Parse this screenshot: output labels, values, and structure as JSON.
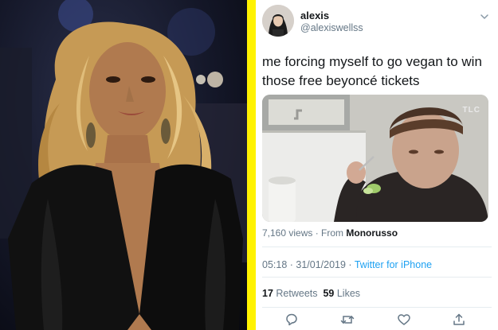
{
  "tweet": {
    "display_name": "alexis",
    "handle": "@alexiswellss",
    "text": "me forcing myself to go vegan to win those free beyoncé tickets",
    "media": {
      "watermark": "TLC"
    },
    "views": {
      "count_label": "7,160 views",
      "separator": " · ",
      "from_label": "From ",
      "source": "Monorusso"
    },
    "meta": {
      "time": "05:18",
      "separator": " · ",
      "date": "31/01/2019",
      "client": "Twitter for iPhone"
    },
    "stats": {
      "retweets_count": "17",
      "retweets_label": "Retweets",
      "likes_count": "59",
      "likes_label": "Likes"
    },
    "actions": [
      {
        "icon": "reply-icon"
      },
      {
        "icon": "retweet-icon"
      },
      {
        "icon": "like-icon"
      },
      {
        "icon": "share-icon"
      }
    ]
  },
  "colors": {
    "divider": "#fff200",
    "link": "#1da1f2",
    "secondary_text": "#657786",
    "primary_text": "#14171a"
  }
}
